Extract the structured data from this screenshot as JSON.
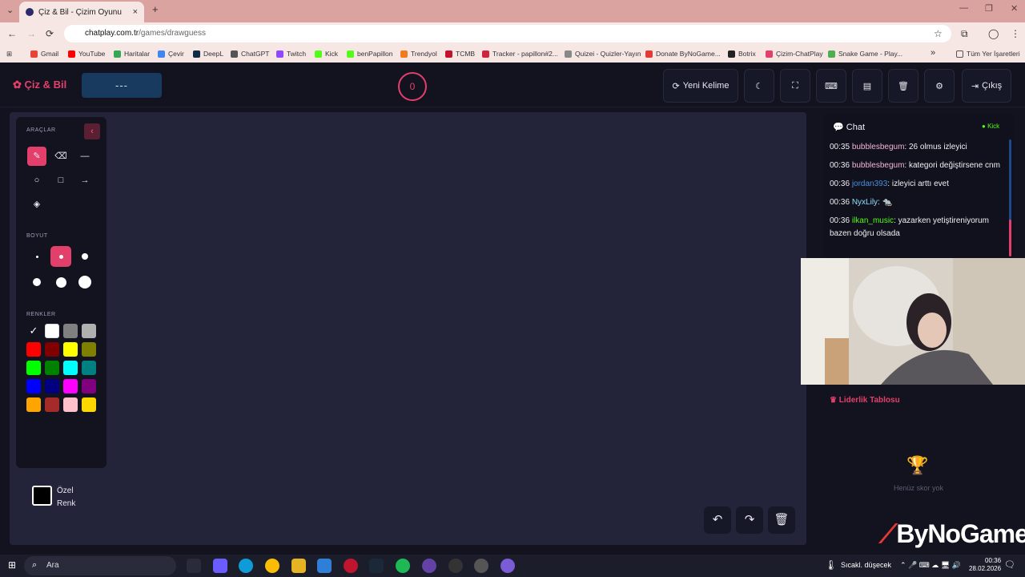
{
  "browser": {
    "tab_title": "Çiz & Bil - Çizim Oyunu",
    "tab_close": "×",
    "new_tab": "+",
    "url_host": "chatplay.com.tr",
    "url_path": "/games/drawguess",
    "bookmarks": [
      "Gmail",
      "YouTube",
      "Haritalar",
      "Çevir",
      "DeepL",
      "ChatGPT",
      "Twitch",
      "Kick",
      "benPapillon",
      "Trendyol",
      "TCMB",
      "Tracker - papillon#2...",
      "Quizei - Quizler-Yayın",
      "Donate ByNoGame...",
      "Botrix",
      "Çizim-ChatPlay",
      "Snake Game - Play..."
    ],
    "bookmarks_more": "»",
    "all_bookmarks": "Tüm Yer İşaretleri"
  },
  "app": {
    "logo": "Çiz & Bil",
    "word": "---",
    "timer": "0",
    "buttons": {
      "new_word": "Yeni Kelime",
      "exit": "Çıkış"
    },
    "toolbar": {
      "tools_title": "ARAÇLAR",
      "size_title": "BOYUT",
      "colors_title": "RENKLER",
      "custom_color_1": "Özel",
      "custom_color_2": "Renk",
      "colors": [
        "#000000",
        "#ffffff",
        "#808080",
        "#b0b0b0",
        "#ff0000",
        "#800000",
        "#ffff00",
        "#808000",
        "#00ff00",
        "#008000",
        "#00ffff",
        "#008080",
        "#0000ff",
        "#000080",
        "#ff00ff",
        "#800080",
        "#ffa500",
        "#a52a2a",
        "#ffc0cb",
        "#ffd700"
      ]
    },
    "chat": {
      "title": "Chat",
      "platform": "Kick",
      "messages": [
        {
          "time": "00:35",
          "user": "bubblesbegum",
          "text": ": 26 olmus izleyici",
          "color": "#f6b6d8"
        },
        {
          "time": "00:36",
          "user": "bubblesbegum",
          "text": ": kategori değiştirsene cnm",
          "color": "#f6b6d8"
        },
        {
          "time": "00:36",
          "user": "jordan393",
          "text": ": izleyici arttı evet",
          "color": "#4a8fe0"
        },
        {
          "time": "00:36",
          "user": "NyxLily",
          "text": ": 🐀",
          "color": "#8ce0ff"
        },
        {
          "time": "00:36",
          "user": "ilkan_music",
          "text": ": yazarken yetiştireniyorum bazen doğru olsada",
          "color": "#53fc18"
        }
      ]
    },
    "leaderboard": {
      "title": "Liderlik Tablosu",
      "empty": "Henüz skor yok"
    },
    "brand": "ByNoGame"
  },
  "taskbar": {
    "search": "Ara",
    "weather": "Sıcakl. düşecek",
    "time": "00:36",
    "date": "28.02.2026"
  }
}
